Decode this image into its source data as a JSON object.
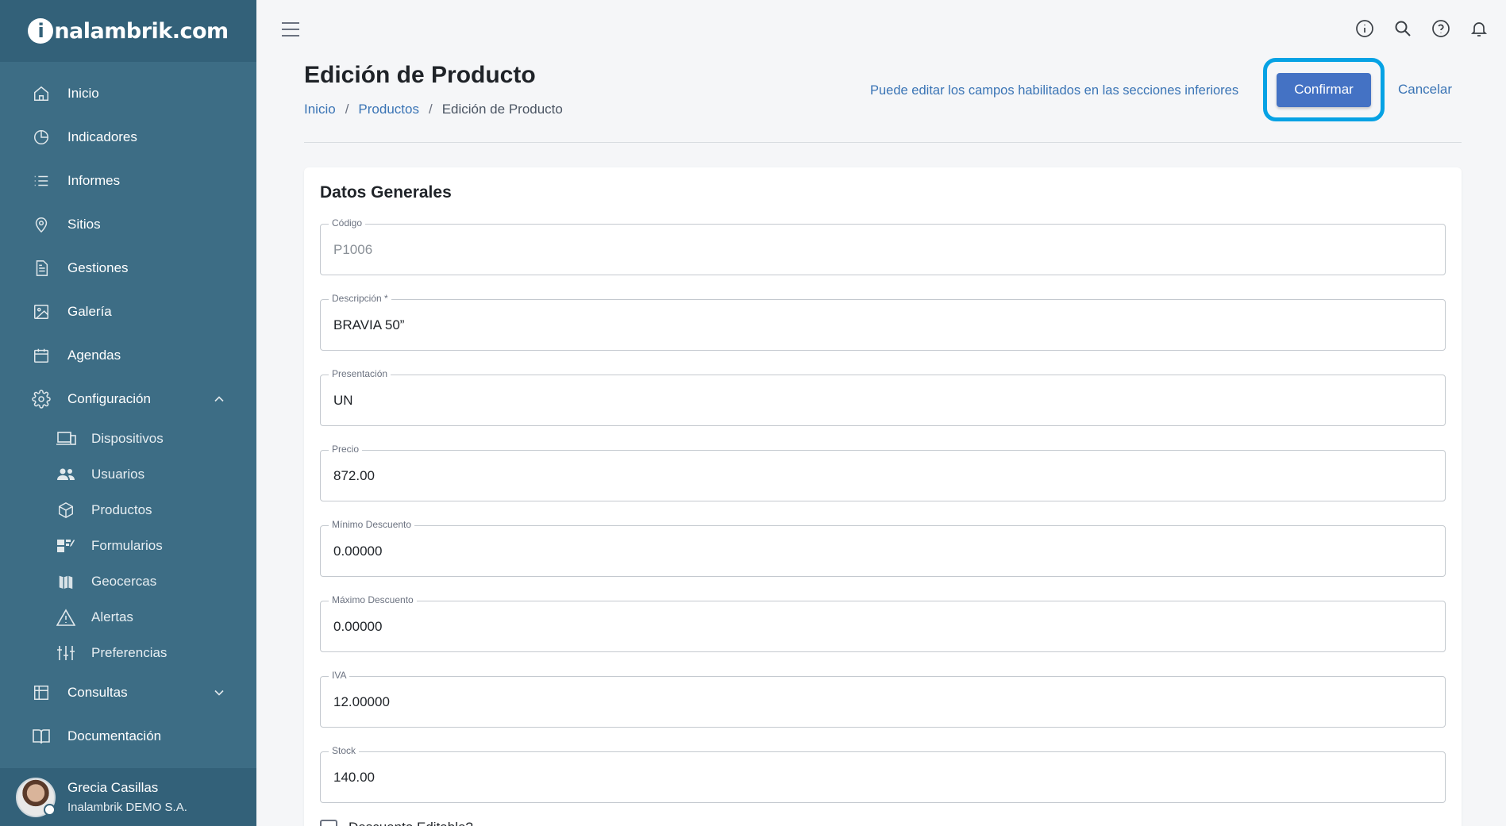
{
  "brand": {
    "logo_i": "i",
    "logo_text": "nalambrik.com"
  },
  "sidebar": {
    "items": [
      {
        "label": "Inicio",
        "icon": "home-icon"
      },
      {
        "label": "Indicadores",
        "icon": "pie-chart-icon"
      },
      {
        "label": "Informes",
        "icon": "list-icon"
      },
      {
        "label": "Sitios",
        "icon": "map-pin-icon"
      },
      {
        "label": "Gestiones",
        "icon": "document-icon"
      },
      {
        "label": "Galería",
        "icon": "image-icon"
      },
      {
        "label": "Agendas",
        "icon": "calendar-icon"
      },
      {
        "label": "Configuración",
        "icon": "gear-icon"
      }
    ],
    "sub_items": [
      {
        "label": "Dispositivos",
        "icon": "devices-icon"
      },
      {
        "label": "Usuarios",
        "icon": "users-icon"
      },
      {
        "label": "Productos",
        "icon": "box-icon"
      },
      {
        "label": "Formularios",
        "icon": "forms-icon"
      },
      {
        "label": "Geocercas",
        "icon": "map-icon"
      },
      {
        "label": "Alertas",
        "icon": "warning-icon"
      },
      {
        "label": "Preferencias",
        "icon": "sliders-icon"
      }
    ],
    "bottom_items": [
      {
        "label": "Consultas",
        "icon": "table-icon"
      },
      {
        "label": "Documentación",
        "icon": "book-icon"
      }
    ]
  },
  "user": {
    "name": "Grecia Casillas",
    "company": "Inalambrik DEMO S.A."
  },
  "header": {
    "title": "Edición de Producto",
    "breadcrumb": [
      "Inicio",
      "Productos",
      "Edición de Producto"
    ],
    "separator": "/",
    "hint": "Puede editar los campos habilitados en las secciones inferiores",
    "confirm_label": "Confirmar",
    "cancel_label": "Cancelar"
  },
  "form": {
    "section_title": "Datos Generales",
    "fields": [
      {
        "label": "Código",
        "value": "P1006",
        "disabled": true
      },
      {
        "label": "Descripción *",
        "value": "BRAVIA 50”"
      },
      {
        "label": "Presentación",
        "value": "UN"
      },
      {
        "label": "Precio",
        "value": "872.00"
      },
      {
        "label": "Mínimo Descuento",
        "value": "0.00000"
      },
      {
        "label": "Máximo Descuento",
        "value": "0.00000"
      },
      {
        "label": "IVA",
        "value": "12.00000"
      },
      {
        "label": "Stock",
        "value": "140.00"
      }
    ],
    "checkbox_label": "Descuento Editable?"
  },
  "colors": {
    "sidebar_bg": "#3d6d85",
    "sidebar_dark": "#336179",
    "accent": "#4472c4",
    "link": "#3a74b5",
    "highlight": "#06a2e4"
  }
}
